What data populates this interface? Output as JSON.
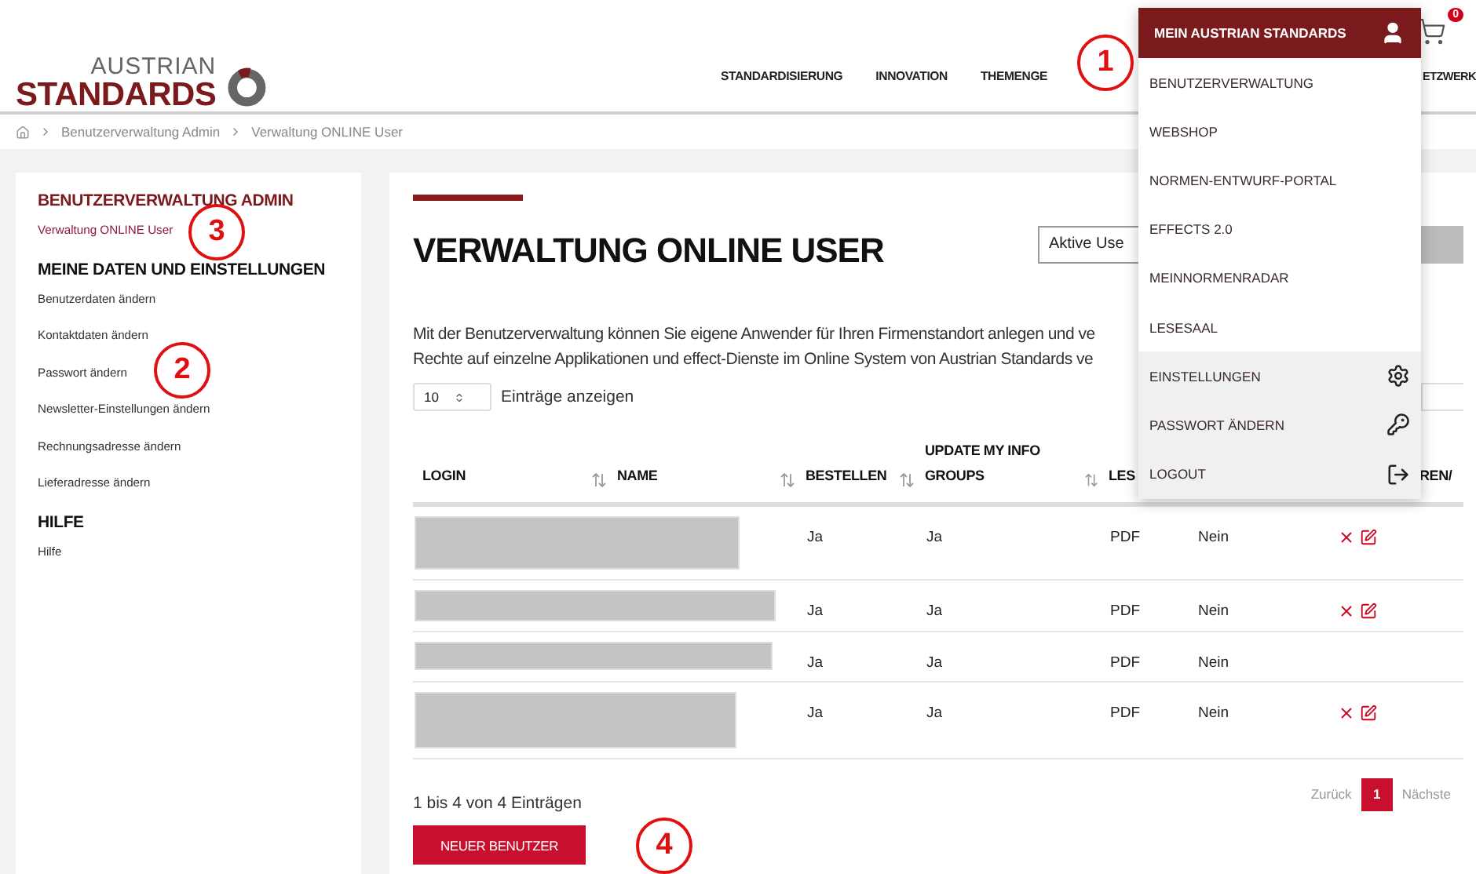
{
  "logo": {
    "top": "AUSTRIAN",
    "bottom": "STANDARDS"
  },
  "cart": {
    "count": "0"
  },
  "nav": [
    "STANDARDISIERUNG",
    "INNOVATION",
    "THEMENGE"
  ],
  "nav_cut": "ETZWERK",
  "breadcrumb": [
    "Benutzerverwaltung Admin",
    "Verwaltung ONLINE User"
  ],
  "sidebar": [
    {
      "title": "BENUTZERVERWALTUNG ADMIN",
      "active": true,
      "items": [
        {
          "label": "Verwaltung ONLINE User",
          "selected": true
        }
      ]
    },
    {
      "title": "MEINE DATEN UND EINSTELLUNGEN",
      "active": false,
      "items": [
        {
          "label": "Benutzerdaten ändern",
          "selected": false
        },
        {
          "label": "Kontaktdaten ändern",
          "selected": false
        },
        {
          "label": "Passwort ändern",
          "selected": false
        },
        {
          "label": "Newsletter-Einstellungen ändern",
          "selected": false
        },
        {
          "label": "Rechnungsadresse ändern",
          "selected": false
        },
        {
          "label": "Lieferadresse ändern",
          "selected": false
        }
      ]
    },
    {
      "title": "HILFE",
      "active": false,
      "items": [
        {
          "label": "Hilfe",
          "selected": false
        }
      ]
    }
  ],
  "main": {
    "title": "VERWALTUNG ONLINE USER",
    "filter_value": "Aktive Use",
    "intro_lines": [
      "Mit der Benutzerverwaltung können Sie eigene Anwender für Ihren Firmenstandort anlegen und ve",
      "Rechte auf einzelne Applikationen und effect-Dienste im Online System von Austrian Standards ve"
    ],
    "page_size": "10",
    "page_size_label": "Einträge anzeigen"
  },
  "table": {
    "columns": [
      {
        "label": "LOGIN",
        "sortable": true
      },
      {
        "label": "NAME",
        "sortable": true
      },
      {
        "label": "BESTELLEN",
        "sortable": true
      },
      {
        "label": "UPDATE MY INFO GROUPS",
        "sortable": true
      },
      {
        "label": "LES"
      },
      {
        "label": "REN/"
      }
    ],
    "rows": [
      {
        "bestellen": "Ja",
        "groups": "Ja",
        "column_5": "PDF",
        "column_6": "Nein",
        "actions": true
      },
      {
        "bestellen": "Ja",
        "groups": "Ja",
        "column_5": "PDF",
        "column_6": "Nein",
        "actions": true
      },
      {
        "bestellen": "Ja",
        "groups": "Ja",
        "column_5": "PDF",
        "column_6": "Nein",
        "actions": false
      },
      {
        "bestellen": "Ja",
        "groups": "Ja",
        "column_5": "PDF",
        "column_6": "Nein",
        "actions": true
      }
    ]
  },
  "table_info": "1 bis 4 von 4 Einträgen",
  "pagination": {
    "previous": "Zurück",
    "pages": [
      {
        "label": "1",
        "selected": true
      }
    ],
    "next": "Nächste"
  },
  "new_user_button": "NEUER BENUTZER",
  "account_menu": {
    "title": "MEIN AUSTRIAN STANDARDS",
    "items": [
      {
        "label": "BENUTZERVERWALTUNG",
        "kind": "link"
      },
      {
        "label": "WEBSHOP",
        "kind": "link"
      },
      {
        "label": "NORMEN-ENTWURF-PORTAL",
        "kind": "link"
      },
      {
        "label": "EFFECTS 2.0",
        "kind": "link"
      },
      {
        "label": "MEINNORMENRADAR",
        "kind": "link"
      },
      {
        "label": "LESESAAL",
        "kind": "link"
      },
      {
        "label": "EINSTELLUNGEN",
        "kind": "settings"
      },
      {
        "label": "PASSWORT ÄNDERN",
        "kind": "password"
      },
      {
        "label": "LOGOUT",
        "kind": "logout"
      }
    ]
  },
  "annotations": [
    "1",
    "2",
    "3",
    "4"
  ]
}
